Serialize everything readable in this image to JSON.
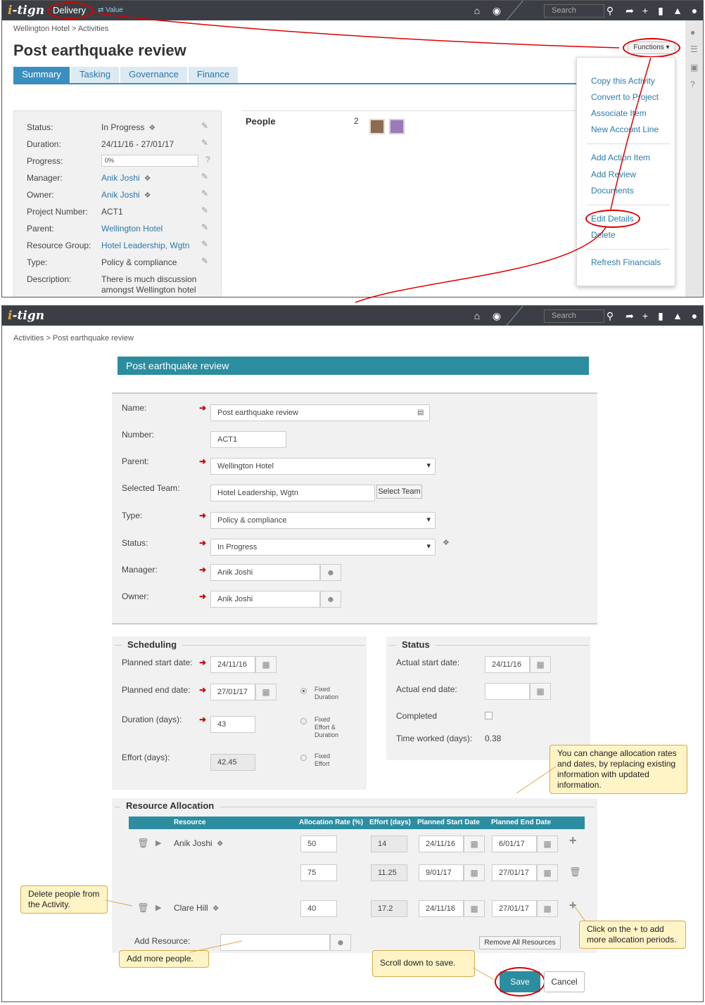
{
  "app": {
    "logo": "i-tign",
    "logo_accent": "i",
    "logo_rest": "-tign",
    "brand_color": "#e8a33d",
    "accent": "#3a8fc1",
    "teal": "#2c8da0"
  },
  "panel1": {
    "module_label": "Delivery",
    "value_label": "⇄ Value",
    "search_placeholder": "Search",
    "breadcrumb": "Wellington Hotel > Activities",
    "title": "Post earthquake review",
    "tabs": [
      "Summary",
      "Tasking",
      "Governance",
      "Finance"
    ],
    "functions_button": "Functions ▾",
    "summary": [
      {
        "label": "Status:",
        "value": "In Progress"
      },
      {
        "label": "Duration:",
        "value": "24/11/16 - 27/01/17"
      },
      {
        "label": "Progress:",
        "value": "0%"
      },
      {
        "label": "Manager:",
        "value": "Anik Joshi"
      },
      {
        "label": "Owner:",
        "value": "Anik Joshi"
      },
      {
        "label": "Project Number:",
        "value": "ACT1"
      },
      {
        "label": "Parent:",
        "value": "Wellington Hotel"
      },
      {
        "label": "Resource Group:",
        "value": "Hotel Leadership, Wgtn"
      },
      {
        "label": "Type:",
        "value": "Policy & compliance"
      },
      {
        "label": "Description:",
        "value": "There is much discussion amongst Wellington hotel"
      }
    ],
    "people_label": "People",
    "people_count": "2",
    "menu": [
      "Copy this Activity",
      "Convert to Project",
      "Associate Item",
      "New Account Line",
      "Add Action Item",
      "Add Review",
      "Documents",
      "Edit Details",
      "Delete",
      "Refresh Financials"
    ]
  },
  "panel2": {
    "search_placeholder": "Search",
    "breadcrumb": "Activities > Post earthquake review",
    "form_title": "Post earthquake review",
    "fields": {
      "name_label": "Name:",
      "name_value": "Post earthquake review",
      "number_label": "Number:",
      "number_value": "ACT1",
      "parent_label": "Parent:",
      "parent_value": "Wellington Hotel",
      "team_label": "Selected Team:",
      "team_value": "Hotel Leadership, Wgtn",
      "team_button": "Select Team",
      "type_label": "Type:",
      "type_value": "Policy & compliance",
      "status_label": "Status:",
      "status_value": "In Progress",
      "manager_label": "Manager:",
      "manager_value": "Anik Joshi",
      "owner_label": "Owner:",
      "owner_value": "Anik Joshi"
    },
    "scheduling": {
      "legend": "Scheduling",
      "start_label": "Planned start date:",
      "start_value": "24/11/16",
      "end_label": "Planned end date:",
      "end_value": "27/01/17",
      "duration_label": "Duration (days):",
      "duration_value": "43",
      "effort_label": "Effort (days):",
      "effort_value": "42.45",
      "radio_fixed_duration": "Fixed\nDuration",
      "radio_fixed_effort_duration": "Fixed\nEffort &\nDuration",
      "radio_fixed_effort": "Fixed\nEffort"
    },
    "status_box": {
      "legend": "Status",
      "actual_start_label": "Actual start date:",
      "actual_start_value": "24/11/16",
      "actual_end_label": "Actual end date:",
      "actual_end_value": "",
      "completed_label": "Completed",
      "time_worked_label": "Time worked (days):",
      "time_worked_value": "0.38"
    },
    "resources": {
      "legend": "Resource Allocation",
      "headers": [
        "Resource",
        "Allocation Rate (%)",
        "Effort (days)",
        "Planned Start Date",
        "Planned End Date"
      ],
      "rows": [
        {
          "name": "Anik Joshi",
          "rate": "50",
          "effort": "14",
          "start": "24/11/16",
          "end": "6/01/17"
        },
        {
          "name": "",
          "rate": "75",
          "effort": "11.25",
          "start": "9/01/17",
          "end": "27/01/17"
        },
        {
          "name": "Clare Hill",
          "rate": "40",
          "effort": "17.2",
          "start": "24/11/16",
          "end": "27/01/17"
        }
      ],
      "add_label": "Add Resource:",
      "remove_all": "Remove All Resources"
    },
    "save_button": "Save",
    "cancel_button": "Cancel",
    "callouts": {
      "allocation": "You can change allocation rates and dates, by replacing existing information with updated  information.",
      "delete": "Delete people from the Activity.",
      "plus": "Click on the + to add more allocation periods.",
      "add_more": "Add more people.",
      "scroll": "Scroll down to save."
    }
  }
}
